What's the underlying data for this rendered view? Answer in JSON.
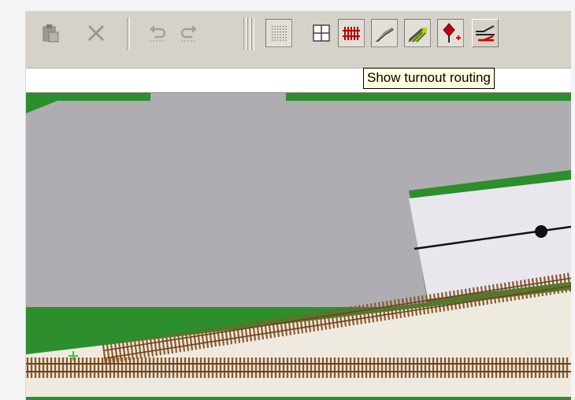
{
  "toolbar": {
    "buttons": [
      {
        "name": "paste",
        "icon": "paste-icon"
      },
      {
        "name": "delete",
        "icon": "delete-x-icon"
      },
      {
        "name": "undo",
        "icon": "undo-icon"
      },
      {
        "name": "redo",
        "icon": "redo-icon"
      },
      {
        "name": "show-dots-grid",
        "icon": "dots-grid-icon"
      },
      {
        "name": "show-grid",
        "icon": "grid-icon"
      },
      {
        "name": "show-track-ties",
        "icon": "track-ties-icon"
      },
      {
        "name": "show-track-bed",
        "icon": "track-bed-icon"
      },
      {
        "name": "show-terrain",
        "icon": "terrain-icon"
      },
      {
        "name": "show-signals",
        "icon": "signal-icon"
      },
      {
        "name": "show-turnout-routing",
        "icon": "turnout-routing-icon"
      }
    ]
  },
  "tooltip": {
    "text": "Show turnout routing"
  },
  "colors": {
    "toolbar": "#d6d2ca",
    "grass": "#2c8e2c",
    "road": "#aeadb1",
    "platform": "#e9e6ee",
    "tie": "#8a5a2b",
    "ballast": "#efeae0"
  }
}
